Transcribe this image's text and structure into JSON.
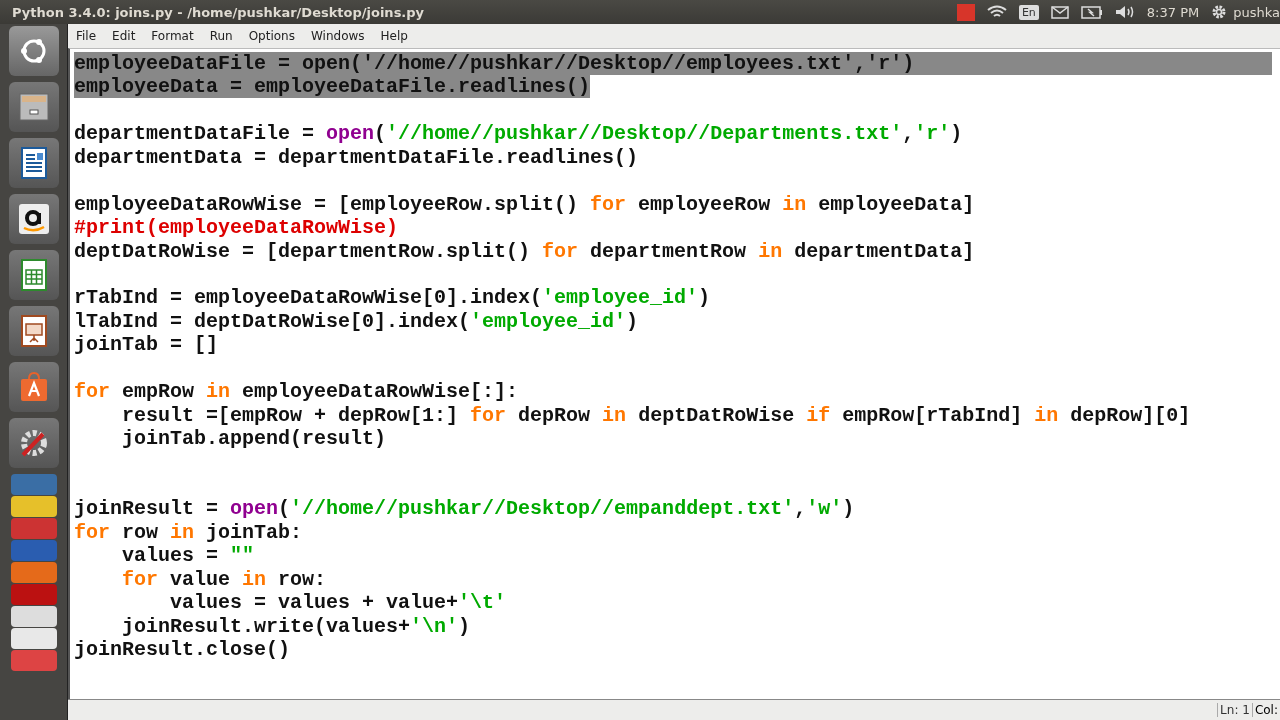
{
  "top_bar": {
    "title": "Python 3.4.0: joins.py - /home/pushkar/Desktop/joins.py",
    "keyboard_layout": "En",
    "clock": "8:37 PM",
    "user": "pushka"
  },
  "menu": [
    "File",
    "Edit",
    "Format",
    "Run",
    "Options",
    "Windows",
    "Help"
  ],
  "code_lines": [
    {
      "selected": true,
      "text": "employeeDataFile = open('//home//pushkar//Desktop//employees.txt','r')"
    },
    {
      "selected": true,
      "text": "employeeData = employeeDataFile.readlines()"
    },
    {
      "selected": false
    },
    {
      "selected": false,
      "tokens": [
        {
          "kind": "plain",
          "t": "departmentDataFile = "
        },
        {
          "kind": "builtin",
          "t": "open"
        },
        {
          "kind": "plain",
          "t": "("
        },
        {
          "kind": "string",
          "t": "'//home//pushkar//Desktop//Departments.txt'"
        },
        {
          "kind": "plain",
          "t": ","
        },
        {
          "kind": "string",
          "t": "'r'"
        },
        {
          "kind": "plain",
          "t": ")"
        }
      ]
    },
    {
      "selected": false,
      "tokens": [
        {
          "kind": "plain",
          "t": "departmentData = departmentDataFile.readlines()"
        }
      ]
    },
    {
      "selected": false
    },
    {
      "selected": false,
      "tokens": [
        {
          "kind": "plain",
          "t": "employeeDataRowWise = [employeeRow.split() "
        },
        {
          "kind": "keyword",
          "t": "for"
        },
        {
          "kind": "plain",
          "t": " employeeRow "
        },
        {
          "kind": "keyword",
          "t": "in"
        },
        {
          "kind": "plain",
          "t": " employeeData]"
        }
      ]
    },
    {
      "selected": false,
      "tokens": [
        {
          "kind": "comment",
          "t": "#print(employeeDataRowWise)"
        }
      ]
    },
    {
      "selected": false,
      "tokens": [
        {
          "kind": "plain",
          "t": "deptDatRoWise = [departmentRow.split() "
        },
        {
          "kind": "keyword",
          "t": "for"
        },
        {
          "kind": "plain",
          "t": " departmentRow "
        },
        {
          "kind": "keyword",
          "t": "in"
        },
        {
          "kind": "plain",
          "t": " departmentData]"
        }
      ]
    },
    {
      "selected": false
    },
    {
      "selected": false,
      "tokens": [
        {
          "kind": "plain",
          "t": "rTabInd = employeeDataRowWise[0].index("
        },
        {
          "kind": "string",
          "t": "'employee_id'"
        },
        {
          "kind": "plain",
          "t": ")"
        }
      ]
    },
    {
      "selected": false,
      "tokens": [
        {
          "kind": "plain",
          "t": "lTabInd = deptDatRoWise[0].index("
        },
        {
          "kind": "string",
          "t": "'employee_id'"
        },
        {
          "kind": "plain",
          "t": ")"
        }
      ]
    },
    {
      "selected": false,
      "tokens": [
        {
          "kind": "plain",
          "t": "joinTab = []"
        }
      ]
    },
    {
      "selected": false
    },
    {
      "selected": false,
      "tokens": [
        {
          "kind": "keyword",
          "t": "for"
        },
        {
          "kind": "plain",
          "t": " empRow "
        },
        {
          "kind": "keyword",
          "t": "in"
        },
        {
          "kind": "plain",
          "t": " employeeDataRowWise[:]:"
        }
      ]
    },
    {
      "selected": false,
      "tokens": [
        {
          "kind": "plain",
          "t": "    result =[empRow + depRow[1:] "
        },
        {
          "kind": "keyword",
          "t": "for"
        },
        {
          "kind": "plain",
          "t": " depRow "
        },
        {
          "kind": "keyword",
          "t": "in"
        },
        {
          "kind": "plain",
          "t": " deptDatRoWise "
        },
        {
          "kind": "keyword",
          "t": "if"
        },
        {
          "kind": "plain",
          "t": " empRow[rTabInd] "
        },
        {
          "kind": "keyword",
          "t": "in"
        },
        {
          "kind": "plain",
          "t": " depRow][0]"
        }
      ]
    },
    {
      "selected": false,
      "tokens": [
        {
          "kind": "plain",
          "t": "    joinTab.append(result)"
        }
      ]
    },
    {
      "selected": false
    },
    {
      "selected": false
    },
    {
      "selected": false,
      "tokens": [
        {
          "kind": "plain",
          "t": "joinResult = "
        },
        {
          "kind": "builtin",
          "t": "open"
        },
        {
          "kind": "plain",
          "t": "("
        },
        {
          "kind": "string",
          "t": "'//home//pushkar//Desktop//empanddept.txt'"
        },
        {
          "kind": "plain",
          "t": ","
        },
        {
          "kind": "string",
          "t": "'w'"
        },
        {
          "kind": "plain",
          "t": ")"
        }
      ]
    },
    {
      "selected": false,
      "tokens": [
        {
          "kind": "keyword",
          "t": "for"
        },
        {
          "kind": "plain",
          "t": " row "
        },
        {
          "kind": "keyword",
          "t": "in"
        },
        {
          "kind": "plain",
          "t": " joinTab:"
        }
      ]
    },
    {
      "selected": false,
      "tokens": [
        {
          "kind": "plain",
          "t": "    values = "
        },
        {
          "kind": "string",
          "t": "\"\""
        }
      ]
    },
    {
      "selected": false,
      "tokens": [
        {
          "kind": "keyword",
          "t": "    for"
        },
        {
          "kind": "plain",
          "t": " value "
        },
        {
          "kind": "keyword",
          "t": "in"
        },
        {
          "kind": "plain",
          "t": " row:"
        }
      ]
    },
    {
      "selected": false,
      "tokens": [
        {
          "kind": "plain",
          "t": "        values = values + value+"
        },
        {
          "kind": "string",
          "t": "'\\t'"
        }
      ]
    },
    {
      "selected": false,
      "tokens": [
        {
          "kind": "plain",
          "t": "    joinResult.write(values+"
        },
        {
          "kind": "string",
          "t": "'\\n'"
        },
        {
          "kind": "plain",
          "t": ")"
        }
      ]
    },
    {
      "selected": false,
      "tokens": [
        {
          "kind": "plain",
          "t": "joinResult.close()"
        }
      ]
    }
  ],
  "status_bar": {
    "line": "Ln: 1",
    "column": "Col:"
  }
}
